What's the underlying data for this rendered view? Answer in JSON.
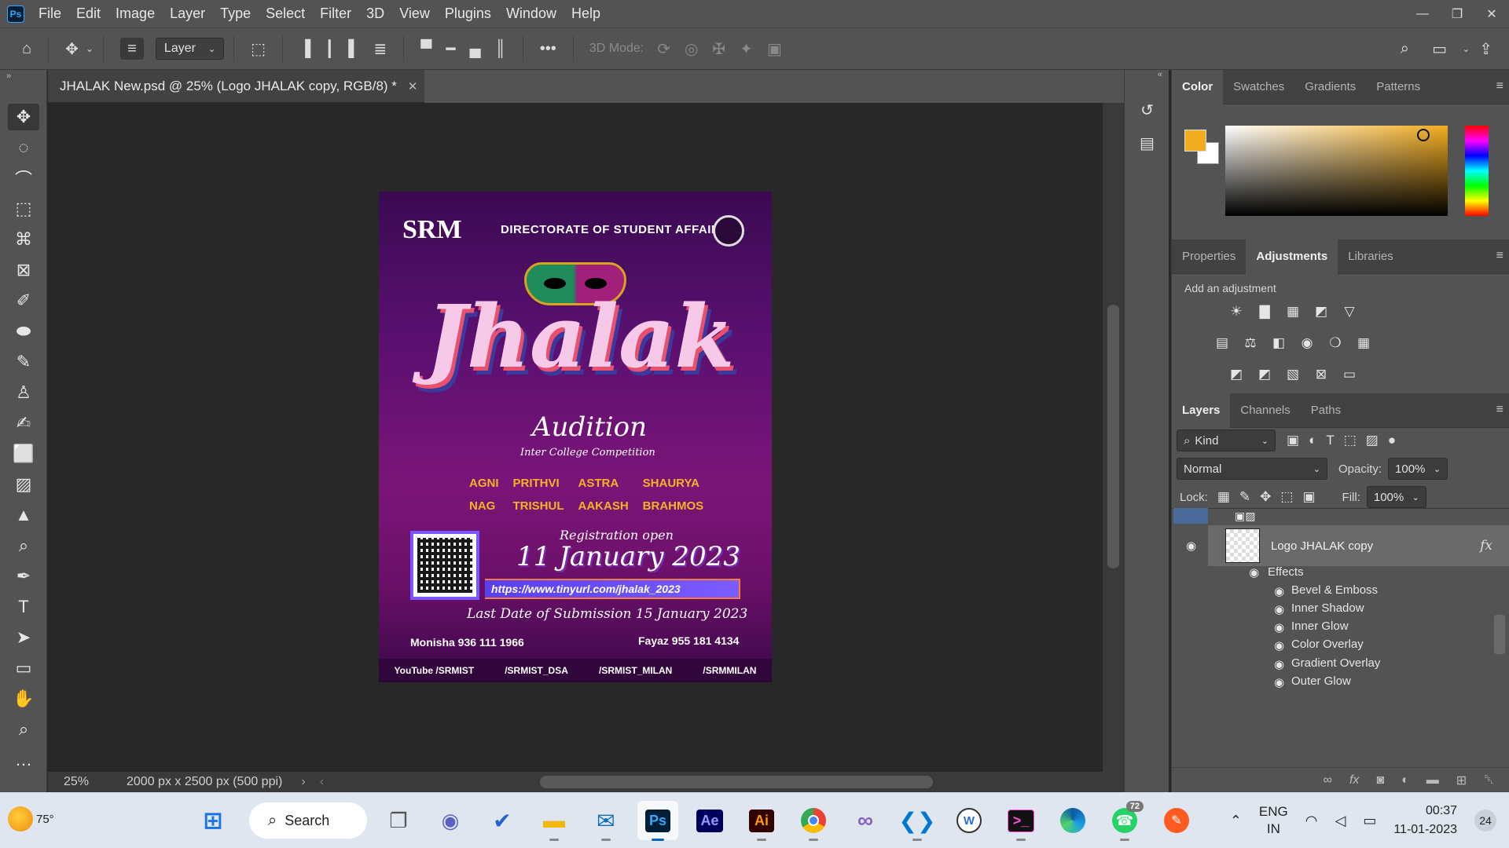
{
  "menubar": {
    "app_icon": "Ps",
    "items": [
      "File",
      "Edit",
      "Image",
      "Layer",
      "Type",
      "Select",
      "Filter",
      "3D",
      "View",
      "Plugins",
      "Window",
      "Help"
    ]
  },
  "options": {
    "auto_select": "Layer",
    "threeD_label": "3D Mode:"
  },
  "document": {
    "tab_title": "JHALAK New.psd @ 25% (Logo JHALAK copy, RGB/8) *",
    "zoom": "25%",
    "info": "2000 px x 2500 px (500 ppi)"
  },
  "poster": {
    "brand": "SRM",
    "directorate": "DIRECTORATE OF STUDENT AFFAIRS",
    "title": "Jhalak",
    "subtitle": "Audition",
    "competition": "Inter College Competition",
    "houses": [
      "AGNI",
      "PRITHVI",
      "ASTRA",
      "SHAURYA",
      "NAG",
      "TRISHUL",
      "AAKASH",
      "BRAHMOS"
    ],
    "registration": "Registration open",
    "date": "11 January 2023",
    "url": "https://www.tinyurl.com/jhalak_2023",
    "last_date": "Last Date of Submission 15 January 2023",
    "contact1": "Monisha  936 111 1966",
    "contact2": "Fayaz  955 181 4134",
    "social": [
      "YouTube /SRMIST",
      "/SRMIST_DSA",
      "/SRMIST_MILAN",
      "/SRMMILAN"
    ]
  },
  "color_panel": {
    "tabs": [
      "Color",
      "Swatches",
      "Gradients",
      "Patterns"
    ],
    "active": "Color",
    "foreground": "#f2ac1f",
    "background": "#ffffff"
  },
  "adjust_panel": {
    "tabs": [
      "Properties",
      "Adjustments",
      "Libraries"
    ],
    "active": "Adjustments",
    "label": "Add an adjustment"
  },
  "layers_panel": {
    "tabs": [
      "Layers",
      "Channels",
      "Paths"
    ],
    "active": "Layers",
    "filter_kind": "Kind",
    "blend_mode": "Normal",
    "opacity_label": "Opacity:",
    "opacity": "100%",
    "lock_label": "Lock:",
    "fill_label": "Fill:",
    "fill": "100%",
    "layer_name": "Logo JHALAK copy",
    "effects_label": "Effects",
    "effects": [
      "Bevel & Emboss",
      "Inner Shadow",
      "Inner Glow",
      "Color Overlay",
      "Gradient Overlay",
      "Outer Glow"
    ]
  },
  "taskbar": {
    "weather": "75°",
    "search": "Search",
    "whatsapp_badge": "72",
    "lang1": "ENG",
    "lang2": "IN",
    "time": "00:37",
    "date": "11-01-2023",
    "notifications": "24"
  }
}
